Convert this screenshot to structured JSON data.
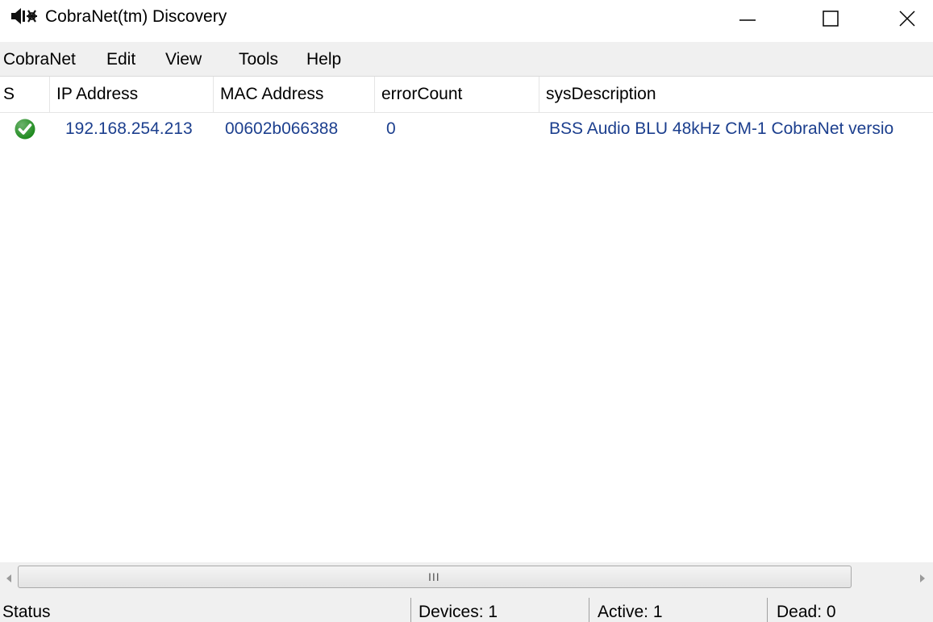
{
  "window": {
    "title": "CobraNet(tm) Discovery",
    "icon": "speaker-icon"
  },
  "menu": {
    "items": [
      "CobraNet",
      "Edit",
      "View",
      "Tools",
      "Help"
    ]
  },
  "list": {
    "columns": [
      "S",
      "IP Address",
      "MAC Address",
      "errorCount",
      "sysDescription"
    ],
    "rows": [
      {
        "status_icon": "check-icon",
        "status_color": "#1e8a1e",
        "ip": "192.168.254.213",
        "mac": "00602b066388",
        "error_count": "0",
        "description": "BSS Audio BLU 48kHz CM-1 CobraNet versio"
      }
    ],
    "text_color": "#1c3f8e"
  },
  "scrollbar": {
    "grip": "III"
  },
  "status": {
    "label": "Status",
    "devices": "Devices: 1",
    "active": "Active: 1",
    "dead": "Dead: 0"
  }
}
